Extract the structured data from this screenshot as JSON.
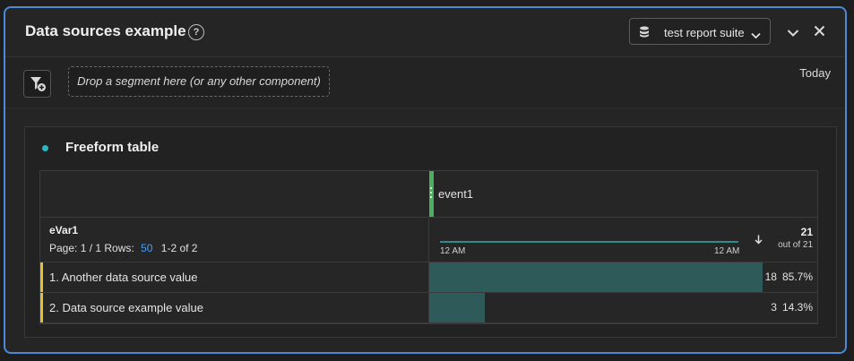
{
  "header": {
    "title": "Data sources example",
    "help_glyph": "?",
    "report_suite": "test report suite"
  },
  "toolbar": {
    "drop_zone": "Drop a segment here (or any other component)",
    "date": "Today"
  },
  "visualization": {
    "title": "Freeform table",
    "dot_color": "#2bb6c4",
    "metric": "event1",
    "dimension": "eVar1",
    "pager": {
      "page_text": "Page: 1 / 1",
      "rows_label": "Rows:",
      "rows_value": "50",
      "range": "1-2 of 2"
    },
    "sparkline": {
      "start_label": "12 AM",
      "end_label": "12 AM"
    },
    "total": "21",
    "total_caption": "out of 21",
    "rows": [
      {
        "label": "1.  Another data source value",
        "value": "18",
        "percent": "85.7%",
        "share": 0.857
      },
      {
        "label": "2.  Data source example value",
        "value": "3",
        "percent": "14.3%",
        "share": 0.143
      }
    ]
  },
  "colors": {
    "accent_border": "#4a8ad8",
    "metric_bar": "#4caf60",
    "row_marker": "#e2c133",
    "value_fill": "#2e5a5a",
    "rows_link": "#4b9cf5"
  }
}
